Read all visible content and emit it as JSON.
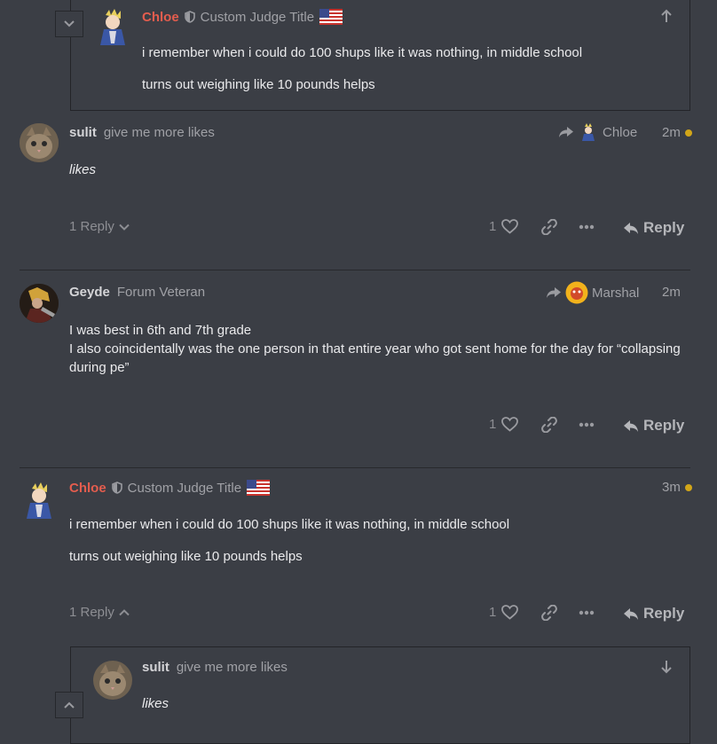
{
  "top_quote": {
    "author": "Chloe",
    "title": "Custom Judge Title",
    "line1": "i remember when i could do 100 shups like it was nothing, in middle school",
    "line2": "turns out weighing like 10 pounds helps"
  },
  "posts": [
    {
      "author": "sulit",
      "title": "give me more likes",
      "reply_to": "Chloe",
      "time": "2m",
      "body": [
        "likes"
      ],
      "replies_label": "1 Reply",
      "likes": "1",
      "reply_label": "Reply"
    },
    {
      "author": "Geyde",
      "title": "Forum Veteran",
      "reply_to": "Marshal",
      "time": "2m",
      "body": [
        "I was best in 6th and 7th grade",
        "I also coincidentally was the one person in that entire year who got sent home for the day for “collapsing during pe”"
      ],
      "likes": "1",
      "reply_label": "Reply"
    },
    {
      "author": "Chloe",
      "title": "Custom Judge Title",
      "time": "3m",
      "body": [
        "i remember when i could do 100 shups like it was nothing, in middle school",
        "turns out weighing like 10 pounds helps"
      ],
      "replies_label": "1 Reply",
      "likes": "1",
      "reply_label": "Reply"
    }
  ],
  "bottom_quote": {
    "author": "sulit",
    "title": "give me more likes",
    "body": "likes"
  },
  "colors": {
    "background": "#3b3e45",
    "accent_red": "#e45d4e",
    "new_dot": "#d2a619"
  }
}
